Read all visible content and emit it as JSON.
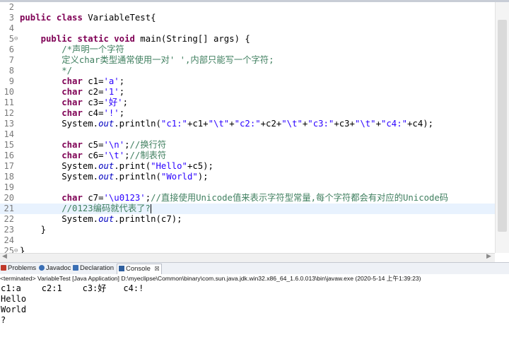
{
  "editor": {
    "lines": [
      {
        "n": "2",
        "code": []
      },
      {
        "n": "3",
        "code": [
          [
            "kw",
            "public"
          ],
          [
            "t",
            " "
          ],
          [
            "kw",
            "class"
          ],
          [
            "t",
            " VariableTest{"
          ]
        ]
      },
      {
        "n": "4",
        "code": []
      },
      {
        "n": "5",
        "fold": "⊖",
        "code": [
          [
            "t",
            "    "
          ],
          [
            "kw",
            "public"
          ],
          [
            "t",
            " "
          ],
          [
            "kw",
            "static"
          ],
          [
            "t",
            " "
          ],
          [
            "kw",
            "void"
          ],
          [
            "t",
            " main(String[] args) {"
          ]
        ]
      },
      {
        "n": "6",
        "code": [
          [
            "t",
            "        "
          ],
          [
            "cm",
            "/*声明一个字符"
          ]
        ]
      },
      {
        "n": "7",
        "code": [
          [
            "t",
            "        "
          ],
          [
            "cm",
            "定义char类型通常使用一对' ',内部只能写一个字符;"
          ]
        ]
      },
      {
        "n": "8",
        "code": [
          [
            "t",
            "        "
          ],
          [
            "cm",
            "*/"
          ]
        ]
      },
      {
        "n": "9",
        "code": [
          [
            "t",
            "        "
          ],
          [
            "kw",
            "char"
          ],
          [
            "t",
            " c1="
          ],
          [
            "str",
            "'a'"
          ],
          [
            "t",
            ";"
          ]
        ]
      },
      {
        "n": "10",
        "code": [
          [
            "t",
            "        "
          ],
          [
            "kw",
            "char"
          ],
          [
            "t",
            " c2="
          ],
          [
            "str",
            "'1'"
          ],
          [
            "t",
            ";"
          ]
        ]
      },
      {
        "n": "11",
        "code": [
          [
            "t",
            "        "
          ],
          [
            "kw",
            "char"
          ],
          [
            "t",
            " c3="
          ],
          [
            "str",
            "'好'"
          ],
          [
            "t",
            ";"
          ]
        ]
      },
      {
        "n": "12",
        "code": [
          [
            "t",
            "        "
          ],
          [
            "kw",
            "char"
          ],
          [
            "t",
            " c4="
          ],
          [
            "str",
            "'!'"
          ],
          [
            "t",
            ";"
          ]
        ]
      },
      {
        "n": "13",
        "code": [
          [
            "t",
            "        System."
          ],
          [
            "fld",
            "out"
          ],
          [
            "t",
            ".println("
          ],
          [
            "str",
            "\"c1:\""
          ],
          [
            "t",
            "+c1+"
          ],
          [
            "str",
            "\"\\t\""
          ],
          [
            "t",
            "+"
          ],
          [
            "str",
            "\"c2:\""
          ],
          [
            "t",
            "+c2+"
          ],
          [
            "str",
            "\"\\t\""
          ],
          [
            "t",
            "+"
          ],
          [
            "str",
            "\"c3:\""
          ],
          [
            "t",
            "+c3+"
          ],
          [
            "str",
            "\"\\t\""
          ],
          [
            "t",
            "+"
          ],
          [
            "str",
            "\"c4:\""
          ],
          [
            "t",
            "+c4);"
          ]
        ]
      },
      {
        "n": "14",
        "code": []
      },
      {
        "n": "15",
        "code": [
          [
            "t",
            "        "
          ],
          [
            "kw",
            "char"
          ],
          [
            "t",
            " c5="
          ],
          [
            "str",
            "'\\n'"
          ],
          [
            "t",
            ";"
          ],
          [
            "cm",
            "//换行符"
          ]
        ]
      },
      {
        "n": "16",
        "code": [
          [
            "t",
            "        "
          ],
          [
            "kw",
            "char"
          ],
          [
            "t",
            " c6="
          ],
          [
            "str",
            "'\\t'"
          ],
          [
            "t",
            ";"
          ],
          [
            "cm",
            "//制表符"
          ]
        ]
      },
      {
        "n": "17",
        "code": [
          [
            "t",
            "        System."
          ],
          [
            "fld",
            "out"
          ],
          [
            "t",
            ".print("
          ],
          [
            "str",
            "\"Hello\""
          ],
          [
            "t",
            "+c5);"
          ]
        ]
      },
      {
        "n": "18",
        "code": [
          [
            "t",
            "        System."
          ],
          [
            "fld",
            "out"
          ],
          [
            "t",
            ".println("
          ],
          [
            "str",
            "\"World\""
          ],
          [
            "t",
            ");"
          ]
        ]
      },
      {
        "n": "19",
        "code": []
      },
      {
        "n": "20",
        "code": [
          [
            "t",
            "        "
          ],
          [
            "kw",
            "char"
          ],
          [
            "t",
            " c7="
          ],
          [
            "str",
            "'\\u0123'"
          ],
          [
            "t",
            ";"
          ],
          [
            "cm",
            "//直接使用Unicode值来表示字符型常量,每个字符都会有对应的Unicode码"
          ]
        ]
      },
      {
        "n": "21",
        "current": true,
        "code": [
          [
            "t",
            "        "
          ],
          [
            "cm",
            "//0123编码就代表了?"
          ],
          [
            "cursor",
            ""
          ]
        ]
      },
      {
        "n": "22",
        "code": [
          [
            "t",
            "        System."
          ],
          [
            "fld",
            "out"
          ],
          [
            "t",
            ".println(c7);"
          ]
        ]
      },
      {
        "n": "23",
        "code": [
          [
            "t",
            "    }"
          ]
        ]
      },
      {
        "n": "24",
        "code": []
      },
      {
        "n": "25",
        "fold": "⊖",
        "code": [
          [
            "t",
            "}"
          ]
        ]
      }
    ]
  },
  "tabs": [
    {
      "label": "Problems",
      "icon": "problems-icon",
      "color": "#c0392b"
    },
    {
      "label": "Javadoc",
      "icon": "javadoc-icon",
      "color": "#3a6fb5"
    },
    {
      "label": "Declaration",
      "icon": "declaration-icon",
      "color": "#3a6fb5"
    },
    {
      "label": "Console",
      "icon": "console-icon",
      "color": "#2f5f9e",
      "active": true,
      "close": "☒"
    }
  ],
  "console": {
    "status": "<terminated> VariableTest [Java Application] D:\\myeclipse\\Common\\binary\\com.sun.java.jdk.win32.x86_64_1.6.0.013\\bin\\javaw.exe (2020-5-14 上午1:39:23)",
    "output": [
      "c1:a\tc2:1\tc3:好\tc4:!",
      "Hello",
      "World",
      "?"
    ]
  }
}
